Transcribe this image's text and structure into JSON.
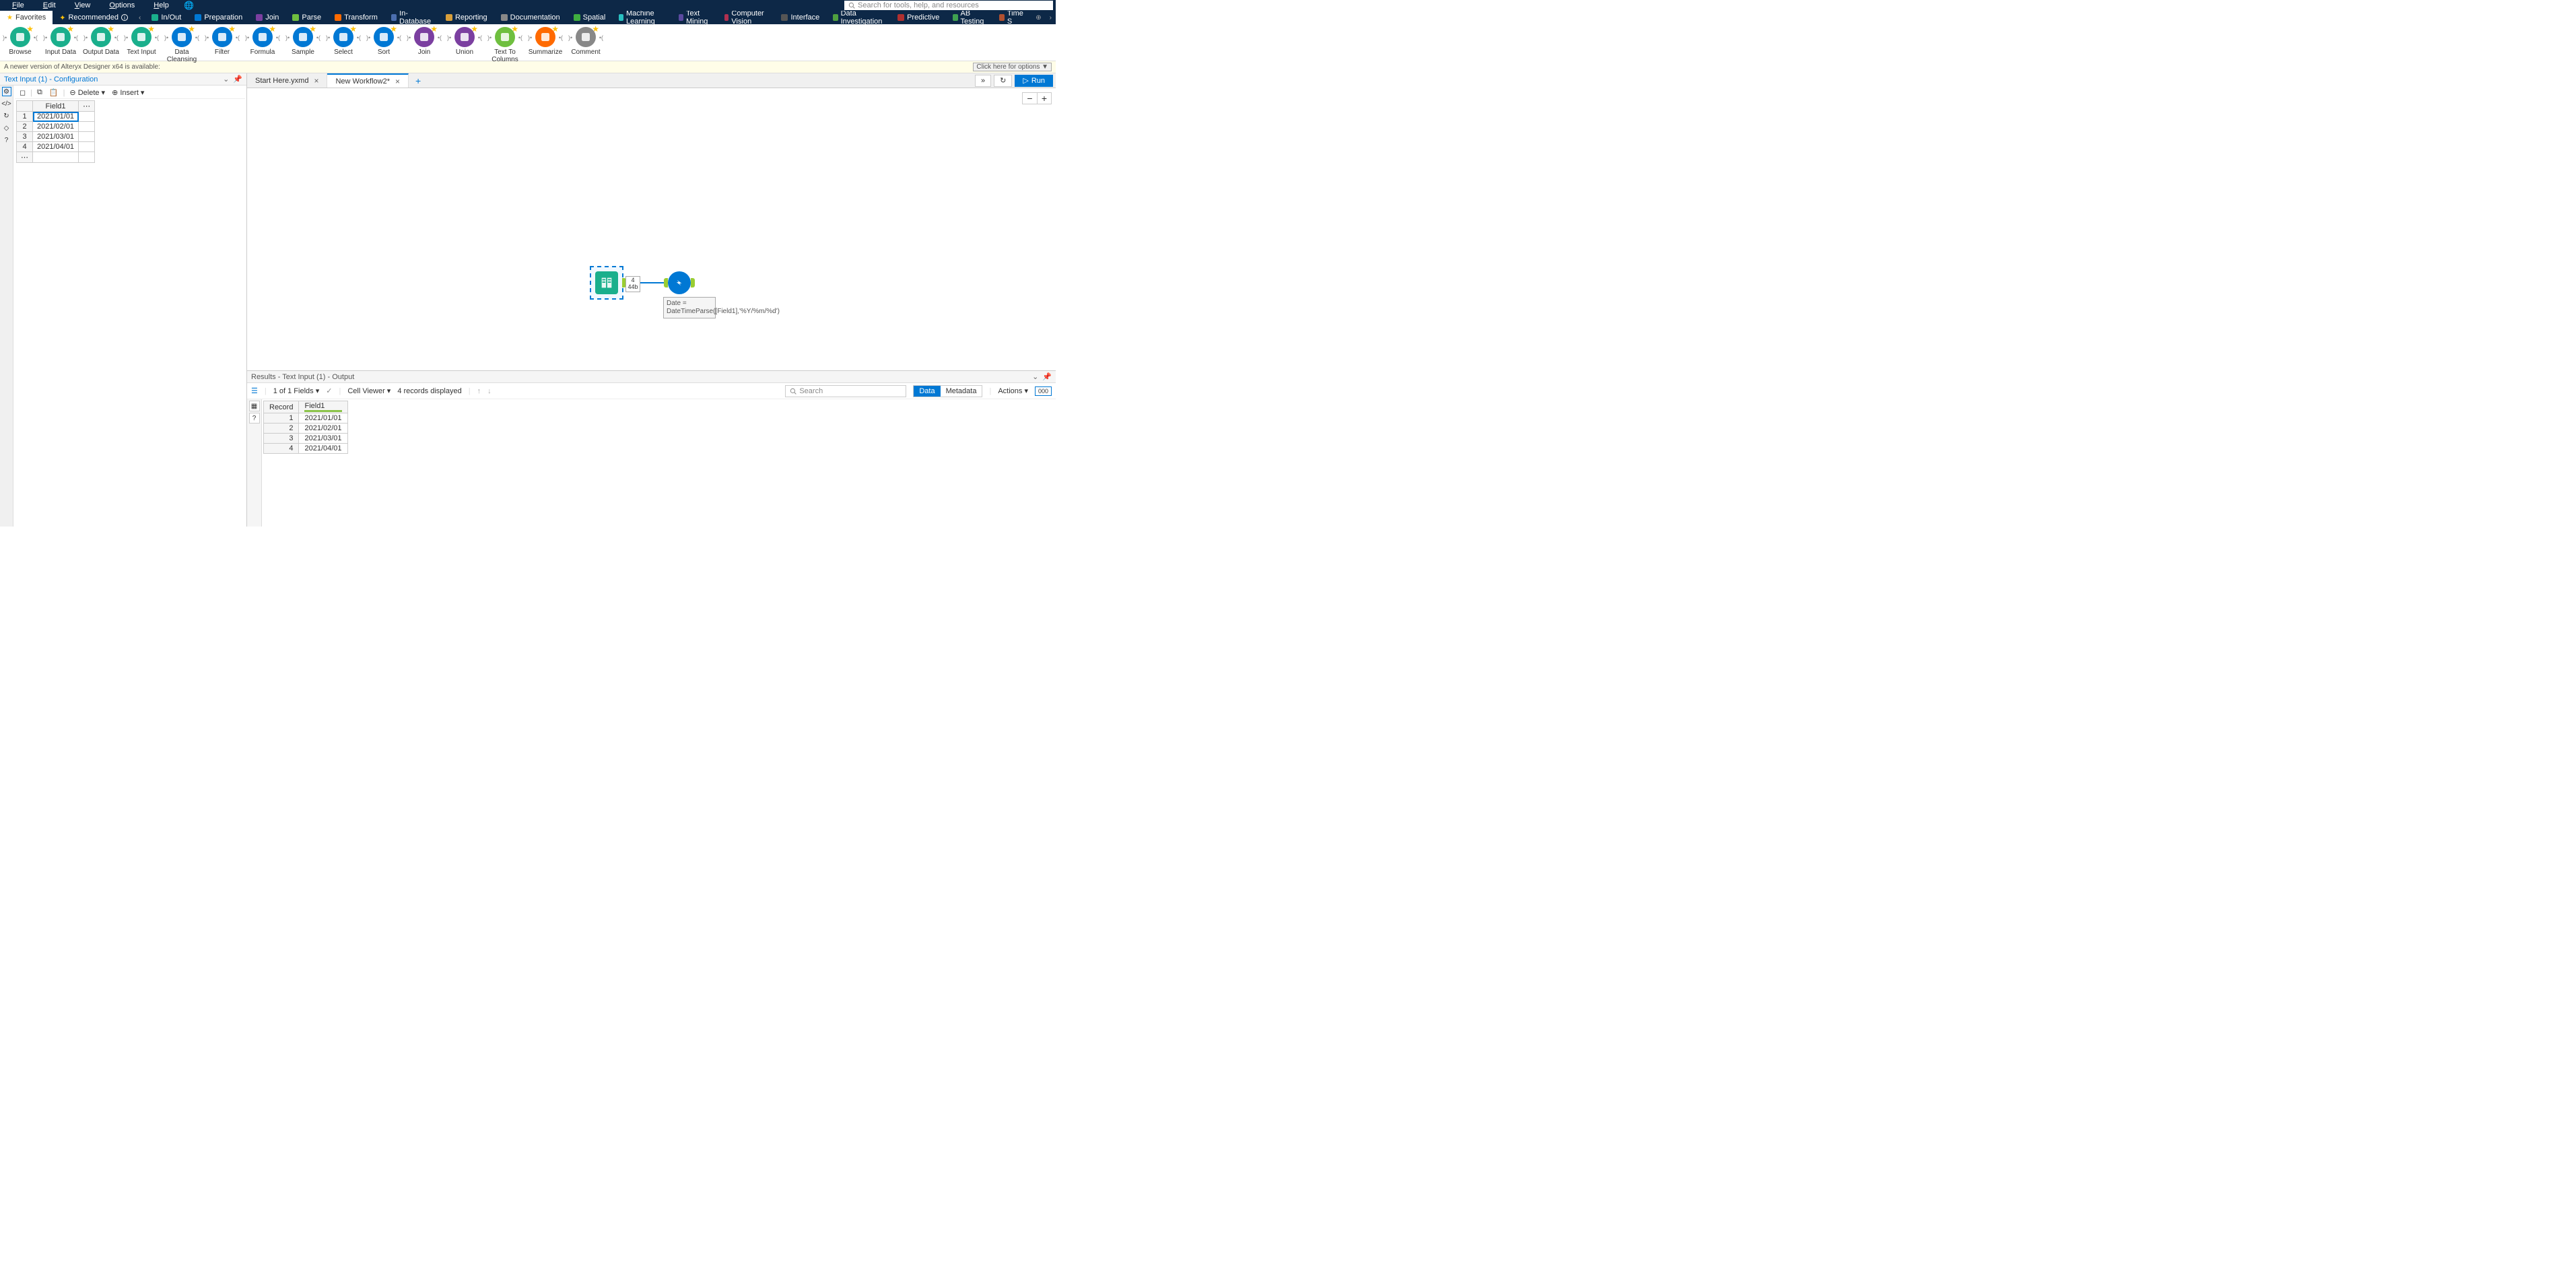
{
  "menu": {
    "file": "File",
    "edit": "Edit",
    "view": "View",
    "options": "Options",
    "help": "Help"
  },
  "search_placeholder": "Search for tools, help, and resources",
  "categories": {
    "favorites": "Favorites",
    "recommended": "Recommended",
    "items": [
      {
        "label": "In/Out",
        "color": "#1aaf8c"
      },
      {
        "label": "Preparation",
        "color": "#0078d4"
      },
      {
        "label": "Join",
        "color": "#7b3fa0"
      },
      {
        "label": "Parse",
        "color": "#6fbf3f"
      },
      {
        "label": "Transform",
        "color": "#ff6a00"
      },
      {
        "label": "In-Database",
        "color": "#4b6eaf"
      },
      {
        "label": "Reporting",
        "color": "#d89f3b"
      },
      {
        "label": "Documentation",
        "color": "#888888"
      },
      {
        "label": "Spatial",
        "color": "#3fae3f"
      },
      {
        "label": "Machine Learning",
        "color": "#2ac0c0"
      },
      {
        "label": "Text Mining",
        "color": "#5b4aa0"
      },
      {
        "label": "Computer Vision",
        "color": "#b03050"
      },
      {
        "label": "Interface",
        "color": "#555555"
      },
      {
        "label": "Data Investigation",
        "color": "#4fa03f"
      },
      {
        "label": "Predictive",
        "color": "#b03030"
      },
      {
        "label": "AB Testing",
        "color": "#3fa050"
      },
      {
        "label": "Time S",
        "color": "#b05030"
      }
    ]
  },
  "tools": [
    {
      "label": "Browse",
      "color": "#1aaf8c"
    },
    {
      "label": "Input Data",
      "color": "#1aaf8c"
    },
    {
      "label": "Output Data",
      "color": "#1aaf8c"
    },
    {
      "label": "Text Input",
      "color": "#1aaf8c"
    },
    {
      "label": "Data Cleansing",
      "color": "#0078d4"
    },
    {
      "label": "Filter",
      "color": "#0078d4"
    },
    {
      "label": "Formula",
      "color": "#0078d4"
    },
    {
      "label": "Sample",
      "color": "#0078d4"
    },
    {
      "label": "Select",
      "color": "#0078d4"
    },
    {
      "label": "Sort",
      "color": "#0078d4"
    },
    {
      "label": "Join",
      "color": "#7b3fa0"
    },
    {
      "label": "Union",
      "color": "#7b3fa0"
    },
    {
      "label": "Text To Columns",
      "color": "#6fbf3f"
    },
    {
      "label": "Summarize",
      "color": "#ff6a00"
    },
    {
      "label": "Comment",
      "color": "#888888"
    }
  ],
  "notification": {
    "text": "A newer version of Alteryx Designer x64 is available:",
    "button": "Click here for options ▼"
  },
  "config": {
    "title": "Text Input (1) - Configuration",
    "delete": "Delete",
    "insert": "Insert",
    "header": "Field1",
    "rows": [
      "2021/01/01",
      "2021/02/01",
      "2021/03/01",
      "2021/04/01"
    ]
  },
  "tabs": {
    "t1": "Start Here.yxmd",
    "t2": "New Workflow2*"
  },
  "run_label": "Run",
  "canvas": {
    "info_count": "4",
    "info_size": "44b",
    "annotation": "Date = DateTimeParse([Field1],'%Y/%m/%d')"
  },
  "results": {
    "title": "Results - Text Input (1) - Output",
    "fields_text": "1 of 1 Fields",
    "cell_viewer": "Cell Viewer",
    "records_text": "4 records displayed",
    "search": "Search",
    "data": "Data",
    "metadata": "Metadata",
    "actions": "Actions",
    "col_record": "Record",
    "col_field1": "Field1",
    "rows": [
      {
        "n": "1",
        "v": "2021/01/01"
      },
      {
        "n": "2",
        "v": "2021/02/01"
      },
      {
        "n": "3",
        "v": "2021/03/01"
      },
      {
        "n": "4",
        "v": "2021/04/01"
      }
    ]
  }
}
